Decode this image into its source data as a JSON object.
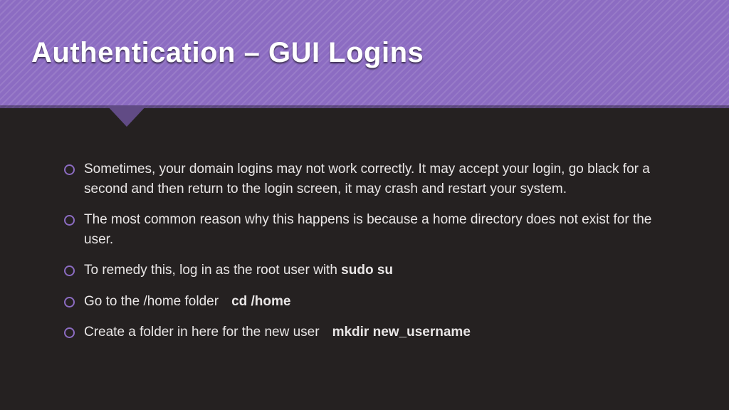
{
  "header": {
    "title": "Authentication – GUI Logins"
  },
  "bullets": [
    {
      "text": "Sometimes, your domain logins may not work correctly. It may accept your login, go black for a second and then return to the login screen, it may crash and restart your system."
    },
    {
      "text": "The most common reason why this happens is because a home directory does not exist for the user."
    },
    {
      "text": "To remedy this, log in as the root user with ",
      "cmd": "sudo su"
    },
    {
      "text": "Go to the /home folder",
      "cmd": "cd /home"
    },
    {
      "text": "Create a folder in here for the new user",
      "cmd": "mkdir new_username"
    }
  ]
}
